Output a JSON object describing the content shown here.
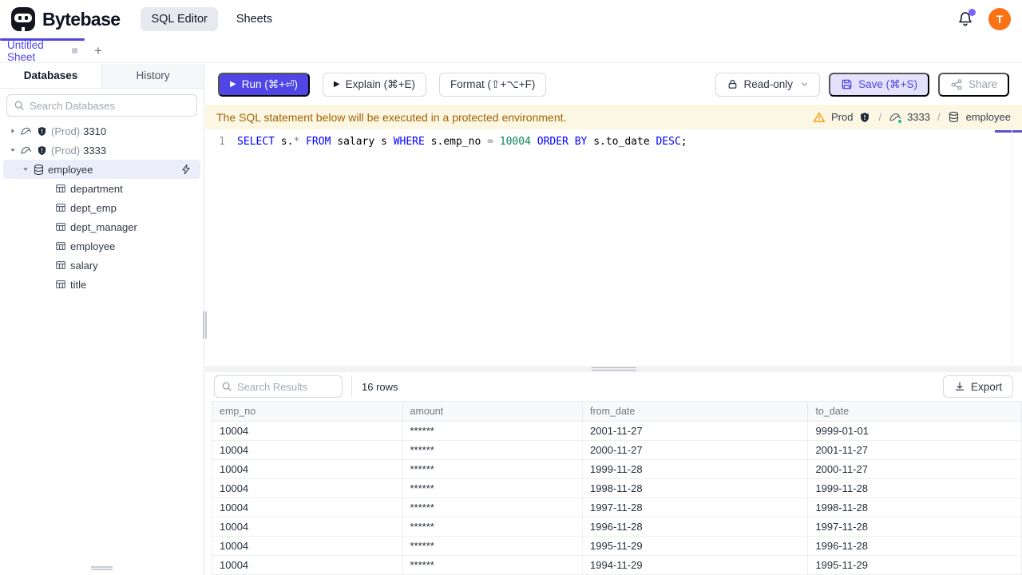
{
  "header": {
    "brand": "Bytebase",
    "nav_items": [
      {
        "label": "SQL Editor",
        "active": true
      },
      {
        "label": "Sheets",
        "active": false
      }
    ],
    "avatar_text": "T"
  },
  "sheet_tabs": {
    "active_tab": "Untitled Sheet",
    "add_button": "+"
  },
  "sidebar": {
    "tabs": [
      {
        "label": "Databases",
        "active": true
      },
      {
        "label": "History",
        "active": false
      }
    ],
    "search_placeholder": "Search Databases",
    "tree": [
      {
        "level": 0,
        "chevron": "right",
        "icons": [
          "mysql-icon",
          "env-shield-icon"
        ],
        "prefix": "(Prod)",
        "label": "3310",
        "selected": false
      },
      {
        "level": 0,
        "chevron": "down",
        "icons": [
          "mysql-icon",
          "env-shield-icon"
        ],
        "prefix": "(Prod)",
        "label": "3333",
        "selected": false
      },
      {
        "level": 1,
        "chevron": "down",
        "icons": [
          "database-icon"
        ],
        "prefix": "",
        "label": "employee",
        "selected": true,
        "trailing_icon": "connect-bolt-icon"
      },
      {
        "level": 2,
        "chevron": null,
        "icons": [
          "table-icon"
        ],
        "prefix": "",
        "label": "department",
        "selected": false
      },
      {
        "level": 2,
        "chevron": null,
        "icons": [
          "table-icon"
        ],
        "prefix": "",
        "label": "dept_emp",
        "selected": false
      },
      {
        "level": 2,
        "chevron": null,
        "icons": [
          "table-icon"
        ],
        "prefix": "",
        "label": "dept_manager",
        "selected": false
      },
      {
        "level": 2,
        "chevron": null,
        "icons": [
          "table-icon"
        ],
        "prefix": "",
        "label": "employee",
        "selected": false
      },
      {
        "level": 2,
        "chevron": null,
        "icons": [
          "table-icon"
        ],
        "prefix": "",
        "label": "salary",
        "selected": false
      },
      {
        "level": 2,
        "chevron": null,
        "icons": [
          "table-icon"
        ],
        "prefix": "",
        "label": "title",
        "selected": false
      }
    ]
  },
  "toolbar": {
    "run": "Run (⌘+⏎)",
    "explain": "Explain (⌘+E)",
    "format": "Format (⇧+⌥+F)",
    "readonly": "Read-only",
    "save": "Save (⌘+S)",
    "share": "Share"
  },
  "banner": {
    "message": "The SQL statement below will be executed in a protected environment.",
    "environment": "Prod",
    "separator": "/",
    "instance": "3333",
    "database": "employee"
  },
  "editor": {
    "line_number": "1",
    "sql_tokens": [
      {
        "text": "SELECT",
        "type": "keyword"
      },
      {
        "text": " s.",
        "type": "plain"
      },
      {
        "text": "*",
        "type": "operator"
      },
      {
        "text": " ",
        "type": "plain"
      },
      {
        "text": "FROM",
        "type": "keyword"
      },
      {
        "text": " salary s ",
        "type": "plain"
      },
      {
        "text": "WHERE",
        "type": "keyword"
      },
      {
        "text": " s.emp_no ",
        "type": "plain"
      },
      {
        "text": "=",
        "type": "operator"
      },
      {
        "text": " ",
        "type": "plain"
      },
      {
        "text": "10004",
        "type": "number"
      },
      {
        "text": " ",
        "type": "plain"
      },
      {
        "text": "ORDER BY",
        "type": "keyword"
      },
      {
        "text": " s.to_date ",
        "type": "plain"
      },
      {
        "text": "DESC",
        "type": "keyword"
      },
      {
        "text": ";",
        "type": "plain"
      }
    ]
  },
  "results": {
    "search_placeholder": "Search Results",
    "row_count_label": "16 rows",
    "export_label": "Export",
    "table": {
      "columns": [
        "emp_no",
        "amount",
        "from_date",
        "to_date"
      ],
      "rows": [
        [
          "10004",
          "******",
          "2001-11-27",
          "9999-01-01"
        ],
        [
          "10004",
          "******",
          "2000-11-27",
          "2001-11-27"
        ],
        [
          "10004",
          "******",
          "1999-11-28",
          "2000-11-27"
        ],
        [
          "10004",
          "******",
          "1998-11-28",
          "1999-11-28"
        ],
        [
          "10004",
          "******",
          "1997-11-28",
          "1998-11-28"
        ],
        [
          "10004",
          "******",
          "1996-11-28",
          "1997-11-28"
        ],
        [
          "10004",
          "******",
          "1995-11-29",
          "1996-11-28"
        ],
        [
          "10004",
          "******",
          "1994-11-29",
          "1995-11-29"
        ]
      ]
    }
  },
  "colors": {
    "accent": "#4f46e5",
    "accent_light_bg": "#e3e1fb",
    "avatar_bg": "#f97316",
    "notification_dot": "#7c62f6",
    "warning_bg": "#fcf7e2",
    "warning_text": "#a16207",
    "warning_icon": "#f59e0b",
    "status_online": "#10b981",
    "sql_keyword": "#0000ff",
    "sql_number": "#098658",
    "sql_operator": "#7a828e"
  }
}
